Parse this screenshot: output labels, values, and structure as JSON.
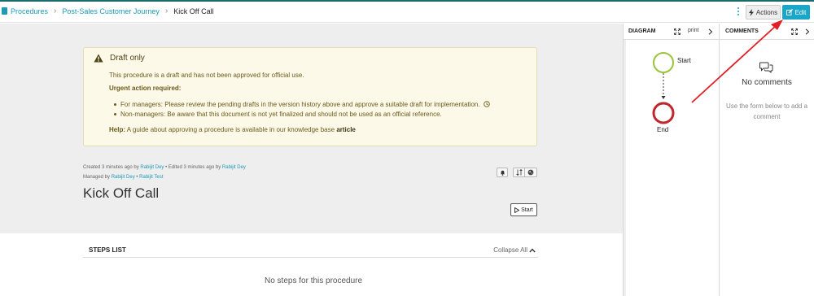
{
  "breadcrumb": {
    "root": "Procedures",
    "parent": "Post-Sales Customer Journey",
    "current": "Kick Off Call"
  },
  "toolbar": {
    "actions_label": "Actions",
    "edit_label": "Edit"
  },
  "draft_notice": {
    "title": "Draft only",
    "line1": "This procedure is a draft and has not been approved for official use.",
    "urgent": "Urgent action required:",
    "bullet_managers": "For managers: Please review the pending drafts in the version history above and approve a suitable draft for implementation.",
    "bullet_nonmanagers": "Non-managers: Be aware that this document is not yet finalized and should not be used as an official reference.",
    "help_label": "Help:",
    "help_text": "A guide about approving a procedure is available in our knowledge base",
    "help_link": "article"
  },
  "meta": {
    "created_prefix": "Created 3 minutes ago by",
    "created_by": "Rabijit Dey",
    "edited_prefix": "• Edited 3 minutes ago by",
    "edited_by": "Rabijit Dey",
    "managed_prefix": "Managed by",
    "manager1": "Rabijit Dey",
    "manager_sep": "•",
    "manager2": "Rabijit Test"
  },
  "procedure": {
    "title": "Kick Off Call",
    "start_label": "Start"
  },
  "steps": {
    "title": "STEPS LIST",
    "collapse_label": "Collapse All",
    "empty_text": "No steps for this procedure"
  },
  "diagram": {
    "label": "DIAGRAM",
    "print_label": "print",
    "start_node": "Start",
    "end_node": "End",
    "start_color": "#9ac33c",
    "end_color": "#c0262d"
  },
  "comments": {
    "label": "COMMENTS",
    "empty_title": "No comments",
    "hint": "Use the form below to add a comment"
  },
  "colors": {
    "accent": "#1aa6c8",
    "annotation_arrow": "#e01f26"
  }
}
